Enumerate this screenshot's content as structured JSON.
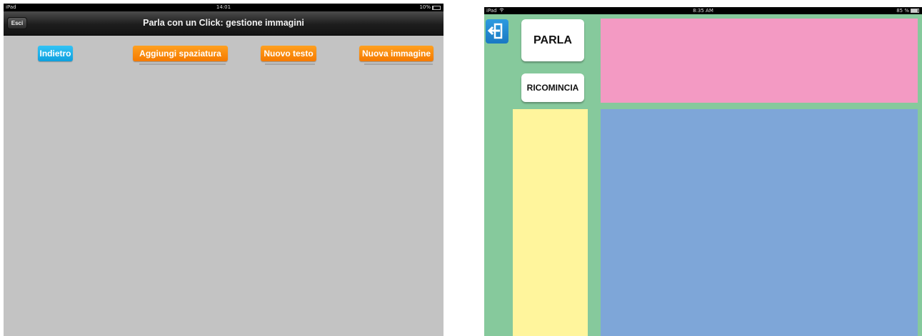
{
  "left_screen": {
    "status_bar": {
      "device": "iPad",
      "time": "14:01",
      "battery": "10%",
      "battery_level": 0.1
    },
    "nav_bar": {
      "title": "Parla con un Click: gestione immagini",
      "exit_button": "Esci"
    },
    "toolbar": {
      "back_button": "Indietro",
      "add_spacing_button": "Aggiungi spaziatura",
      "new_text_button": "Nuovo testo",
      "new_image_button": "Nuova immagine"
    },
    "colors": {
      "background": "#c3c3c3",
      "blue_button": "#1aaee9",
      "orange_button": "#f88a0c"
    }
  },
  "right_screen": {
    "status_bar": {
      "device": "iPad",
      "wifi_icon": "wifi-icon",
      "time": "8:35 AM",
      "battery": "85 %",
      "battery_level": 0.85
    },
    "exit_icon": "exit-arrow-icon",
    "speak_button": "PARLA",
    "restart_button": "RICOMINCIA",
    "colors": {
      "background": "#86c99c",
      "top_panel": "#f39ac3",
      "left_panel": "#fff59c",
      "main_panel": "#7ea6d8",
      "exit_button": "#2289d2"
    }
  }
}
